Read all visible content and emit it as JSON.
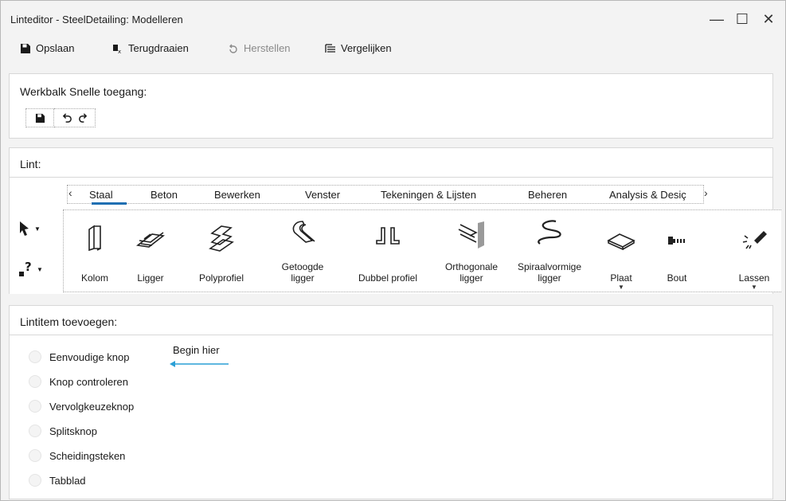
{
  "window": {
    "title": "Linteditor - SteelDetailing: Modelleren",
    "controls": {
      "minimize": "—",
      "maximize": "☐",
      "close": "✕"
    }
  },
  "toolbar": {
    "save_label": "Opslaan",
    "revert_label": "Terugdraaien",
    "restore_label": "Herstellen",
    "compare_label": "Vergelijken"
  },
  "quick_access": {
    "label": "Werkbalk Snelle toegang:",
    "icons": [
      "save-icon",
      "undo-icon",
      "redo-icon"
    ]
  },
  "ribbon": {
    "label": "Lint:",
    "tabs": [
      {
        "label": "Staal",
        "active": true
      },
      {
        "label": "Beton"
      },
      {
        "label": "Bewerken"
      },
      {
        "label": "Venster"
      },
      {
        "label": "Tekeningen & Lijsten"
      },
      {
        "label": "Beheren"
      },
      {
        "label": "Analysis & Desiç"
      }
    ],
    "nav": {
      "prev": "‹",
      "next": "›"
    },
    "left_tools": [
      "pointer-icon",
      "help-icon"
    ],
    "items": [
      {
        "label": "Kolom",
        "icon": "column-icon"
      },
      {
        "label": "Ligger",
        "icon": "beam-icon"
      },
      {
        "label": "Polyprofiel",
        "icon": "polybeam-icon"
      },
      {
        "label": "Getoogde\nligger",
        "icon": "curved-beam-icon"
      },
      {
        "label": "Dubbel profiel",
        "icon": "twin-profile-icon"
      },
      {
        "label": "Orthogonale\nligger",
        "icon": "orthogonal-beam-icon"
      },
      {
        "label": "Spiraalvormige\nligger",
        "icon": "spiral-beam-icon"
      },
      {
        "label": "Plaat",
        "icon": "plate-icon",
        "dropdown": true
      },
      {
        "label": "Bout",
        "icon": "bolt-icon"
      },
      {
        "label": "Lassen",
        "icon": "weld-icon",
        "dropdown": true
      }
    ]
  },
  "add_item": {
    "label": "Lintitem toevoegen:",
    "options": [
      "Eenvoudige knop",
      "Knop controleren",
      "Vervolgkeuzeknop",
      "Splitsknop",
      "Scheidingsteken",
      "Tabblad"
    ],
    "hint": "Begin hier"
  },
  "colors": {
    "accent": "#1f6fb2",
    "hint_arrow": "#2a9fd6"
  }
}
